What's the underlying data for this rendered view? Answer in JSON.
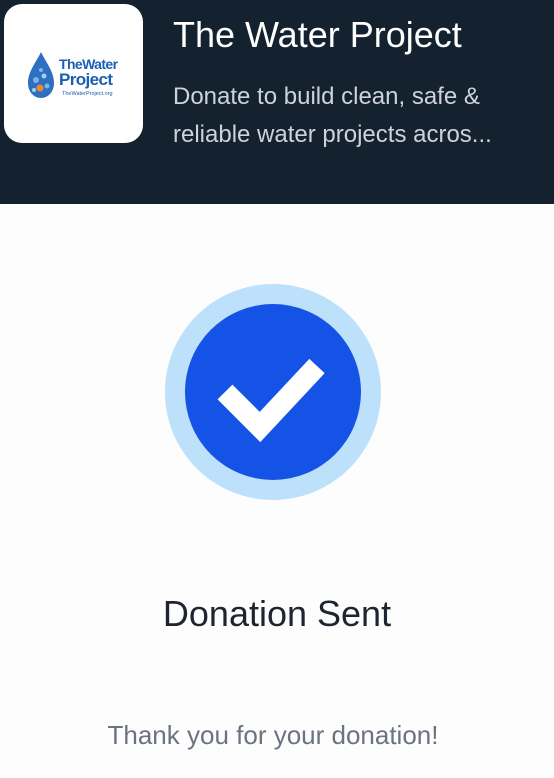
{
  "header": {
    "logo": {
      "line1": "TheWater",
      "line2": "Project",
      "url": "TheWaterProject.org"
    },
    "title": "The Water Project",
    "description": "Donate to build clean, safe & reliable water projects acros..."
  },
  "status": {
    "icon": "checkmark-icon",
    "title": "Donation Sent",
    "message": "Thank you for your donation!"
  },
  "colors": {
    "header_bg": "#14212f",
    "accent_blue": "#1552e6",
    "accent_ring": "#bde0fb",
    "background": "#fdfdfd"
  }
}
